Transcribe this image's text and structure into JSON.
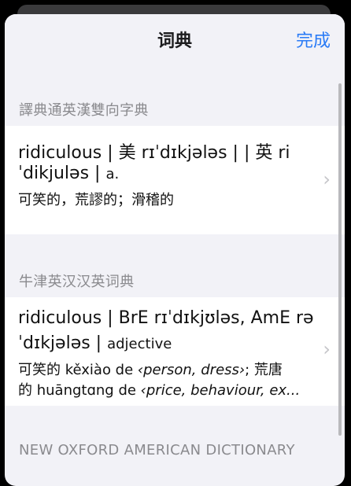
{
  "nav": {
    "title": "词典",
    "done_label": "完成"
  },
  "sections": [
    {
      "header": "譯典通英漢雙向字典",
      "entry": {
        "line1": "ridiculous | 美 rɪˈdɪkjələs | | 英 ri",
        "line2_main": "ˈdikjuləs | ",
        "line2_pos": "a.",
        "line3": "可笑的，荒謬的；滑稽的"
      }
    },
    {
      "header": "牛津英汉汉英词典",
      "entry": {
        "line1": "ridiculous | BrE rɪˈdɪkjʊləs, AmE rə",
        "line2_main": "ˈdɪkjələs | ",
        "line2_pos": "adjective",
        "line3": "可笑的 kěxiào de ‹person, dress›; 荒唐",
        "line4": "的 huāngtɑng de ‹price, behaviour, ex..."
      }
    },
    {
      "header": "NEW OXFORD AMERICAN DICTIONARY"
    }
  ]
}
